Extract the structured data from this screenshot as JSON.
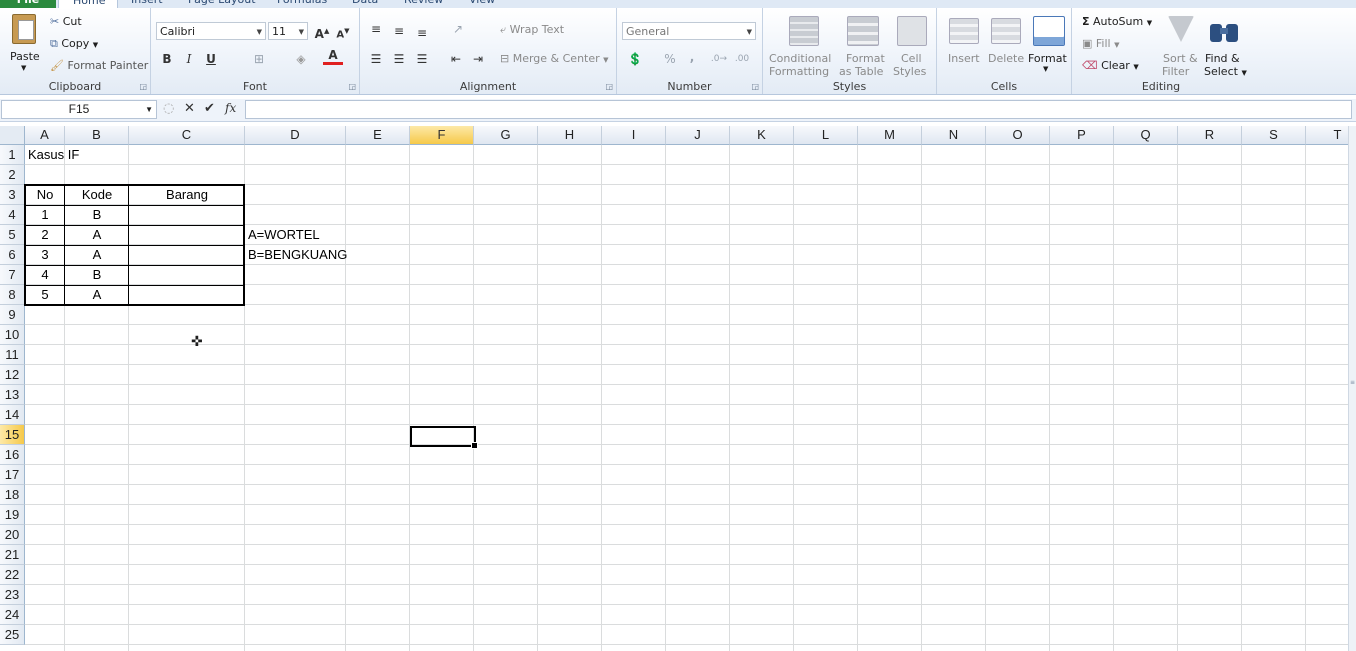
{
  "ribbon": {
    "tabs": [
      "File",
      "Home",
      "Insert",
      "Page Layout",
      "Formulas",
      "Data",
      "Review",
      "View"
    ],
    "clipboard": {
      "label": "Clipboard",
      "paste": "Paste",
      "cut": "Cut",
      "copy": "Copy",
      "format_painter": "Format Painter"
    },
    "font": {
      "label": "Font",
      "family": "Calibri",
      "size": "11",
      "bold": "B",
      "italic": "I",
      "underline": "U"
    },
    "alignment": {
      "label": "Alignment",
      "wrap_text": "Wrap Text",
      "merge_center": "Merge & Center"
    },
    "number": {
      "label": "Number",
      "format": "General",
      "percent": "%",
      "comma": ","
    },
    "styles": {
      "label": "Styles",
      "conditional_formatting_1": "Conditional",
      "conditional_formatting_2": "Formatting",
      "format_table_1": "Format",
      "format_table_2": "as Table",
      "cell_styles_1": "Cell",
      "cell_styles_2": "Styles"
    },
    "cells": {
      "label": "Cells",
      "insert": "Insert",
      "delete": "Delete",
      "format": "Format"
    },
    "editing": {
      "label": "Editing",
      "autosum": "AutoSum",
      "fill": "Fill",
      "clear": "Clear",
      "sort_1": "Sort &",
      "sort_2": "Filter",
      "find_1": "Find &",
      "find_2": "Select"
    }
  },
  "formula_bar": {
    "name_box": "F15",
    "fx": "fx",
    "value": ""
  },
  "sheet": {
    "columns": [
      "A",
      "B",
      "C",
      "D",
      "E",
      "F",
      "G",
      "H",
      "I",
      "J",
      "K",
      "L",
      "M",
      "N",
      "O",
      "P",
      "Q",
      "R",
      "S",
      "T"
    ],
    "rows": [
      "1",
      "2",
      "3",
      "4",
      "5",
      "6",
      "7",
      "8",
      "9",
      "10",
      "11",
      "12",
      "13",
      "14",
      "15",
      "16",
      "17",
      "18",
      "19",
      "20",
      "21",
      "22",
      "23",
      "24",
      "25"
    ],
    "active_cell": "F15",
    "title": "Kasus IF",
    "table": {
      "headers": [
        "No",
        "Kode",
        "Barang"
      ],
      "rows": [
        [
          "1",
          "B",
          ""
        ],
        [
          "2",
          "A",
          ""
        ],
        [
          "3",
          "A",
          ""
        ],
        [
          "4",
          "B",
          ""
        ],
        [
          "5",
          "A",
          ""
        ]
      ]
    },
    "notes": [
      "A=WORTEL",
      "B=BENGKUANG"
    ]
  }
}
